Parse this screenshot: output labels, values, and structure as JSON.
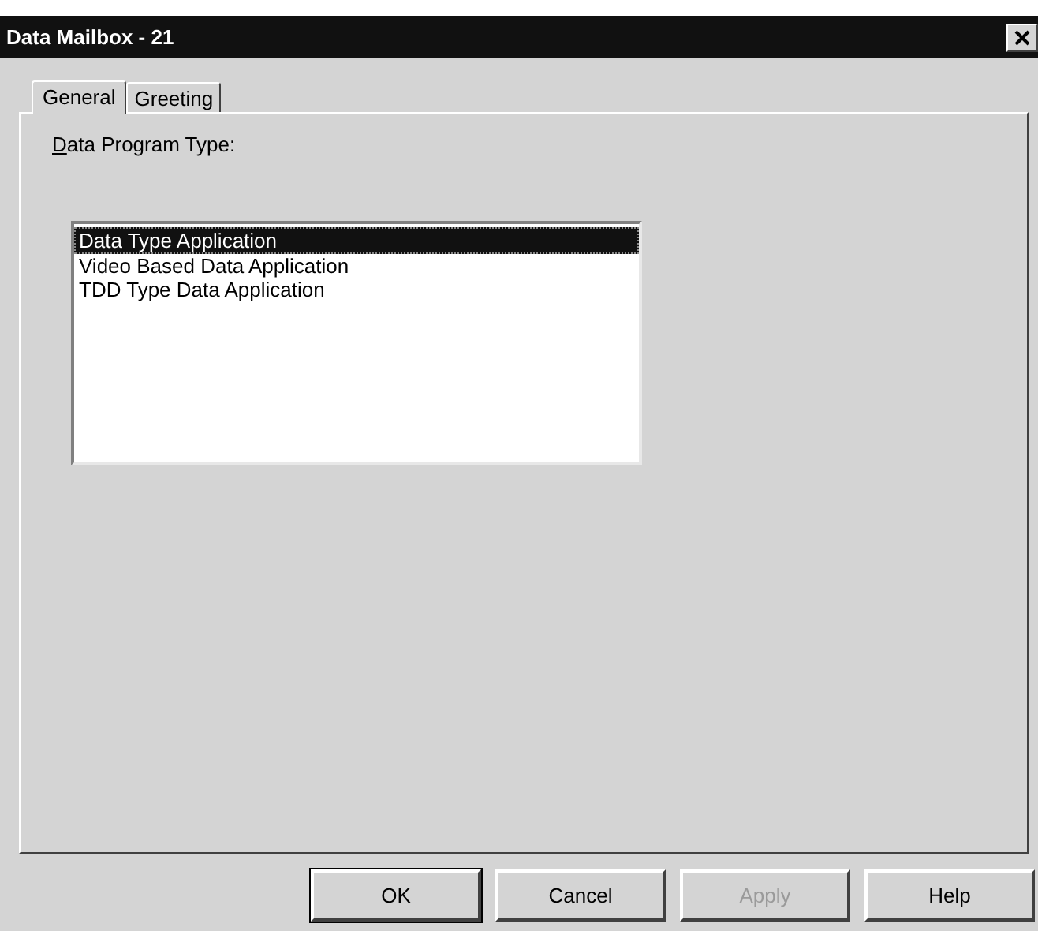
{
  "window": {
    "title": "Data Mailbox - 21"
  },
  "tabs": [
    {
      "label": "General",
      "selected": true
    },
    {
      "label": "Greeting",
      "selected": false
    }
  ],
  "field_label": "Data Program Type:",
  "list_items": [
    {
      "label": "Data Type Application",
      "selected": true
    },
    {
      "label": "Video Based Data Application",
      "selected": false
    },
    {
      "label": "TDD Type Data Application",
      "selected": false
    }
  ],
  "buttons": [
    {
      "label": "OK",
      "disabled": false,
      "default": true
    },
    {
      "label": "Cancel",
      "disabled": false,
      "default": false
    },
    {
      "label": "Apply",
      "disabled": true,
      "default": false
    },
    {
      "label": "Help",
      "disabled": false,
      "default": false
    }
  ]
}
